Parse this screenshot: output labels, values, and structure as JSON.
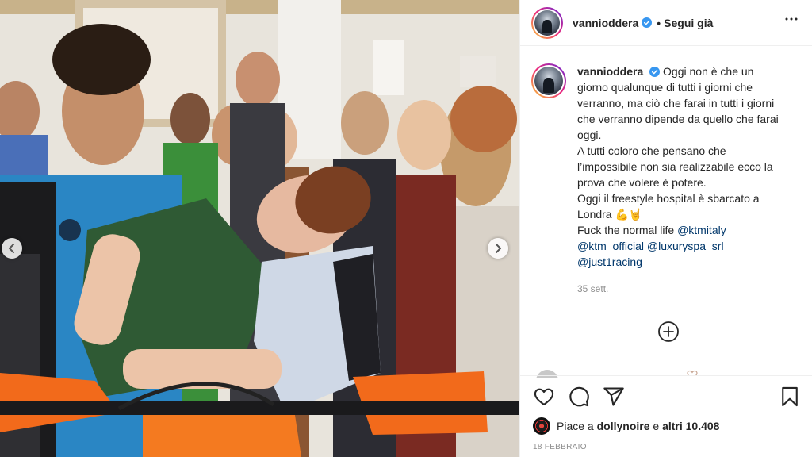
{
  "post": {
    "username": "vannioddera",
    "follow_status": "Segui già",
    "separator": "•",
    "caption_lines": [
      "Oggi non è che un",
      "giorno qualunque di tutti i giorni che",
      "verranno, ma ciò che farai in tutti i giorni",
      "che verranno dipende da quello che farai",
      "oggi.",
      "A tutti coloro che pensano che",
      "l’impossibile non sia realizzabile ecco la",
      "prova che volere è potere.",
      "Oggi il freestyle hospital è sbarcato a",
      "Londra 💪🤘"
    ],
    "caption_tail": "Fuck the normal life",
    "mentions": [
      "@ktmitaly",
      "@ktm_official",
      "@luxuryspa_srl",
      "@just1racing"
    ],
    "time_ago": "35 sett.",
    "likes": {
      "prefix": "Piace a",
      "user": "dollynoire",
      "middle": "e",
      "rest": "altri 10.408"
    },
    "date": "18 FEBBRAIO"
  },
  "icons": {
    "verified": "verified-badge-icon",
    "more": "more-options-icon",
    "load_more": "plus-circle-icon",
    "like": "heart-icon",
    "comment": "comment-icon",
    "share": "share-icon",
    "save": "bookmark-icon",
    "prev": "chevron-left-icon",
    "next": "chevron-right-icon"
  },
  "colors": {
    "verified_blue": "#3897f0",
    "mention": "#00376b",
    "text": "#262626",
    "muted": "#8e8e8e",
    "story_ring": [
      "#f9ce34",
      "#ee2a7b",
      "#6228d7"
    ]
  }
}
